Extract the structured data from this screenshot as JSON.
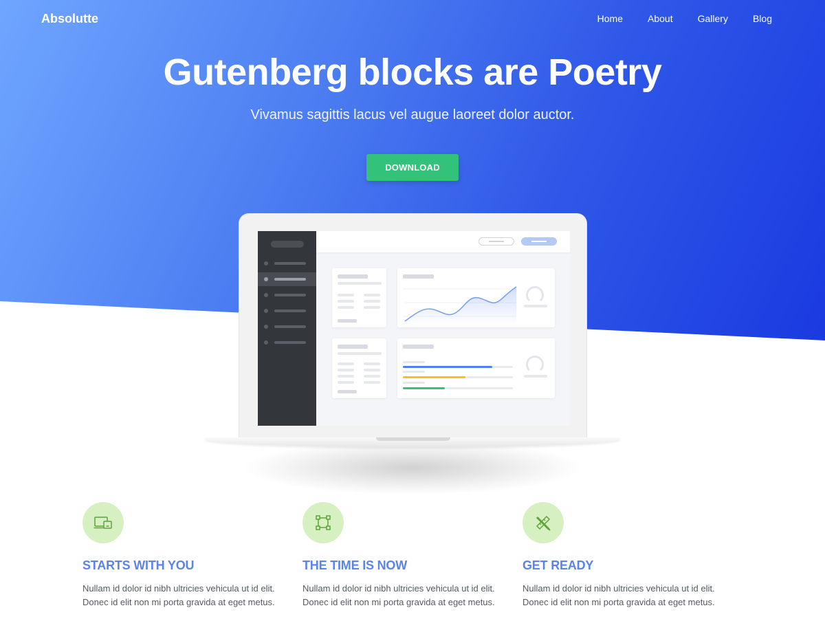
{
  "header": {
    "brand": "Absolutte",
    "nav": [
      {
        "label": "Home"
      },
      {
        "label": "About"
      },
      {
        "label": "Gallery"
      },
      {
        "label": "Blog"
      }
    ]
  },
  "hero": {
    "title": "Gutenberg blocks are Poetry",
    "subtitle": "Vivamus sagittis lacus vel augue laoreet dolor auctor.",
    "cta_label": "DOWNLOAD"
  },
  "colors": {
    "hero_gradient_start": "#6fa6ff",
    "hero_gradient_end": "#1a3ae0",
    "cta": "#33c27a",
    "feature_title": "#5b84e6",
    "feature_icon_bg": "#d7f0c2",
    "feature_icon_stroke": "#5fa33a"
  },
  "mockup": {
    "progress_bars": [
      {
        "color": "#4f7ff0",
        "fraction": 0.81
      },
      {
        "color": "#f4c21c",
        "fraction": 0.57
      },
      {
        "color": "#33c27a",
        "fraction": 0.38
      }
    ]
  },
  "features": [
    {
      "icon": "devices-icon",
      "title": "STARTS WITH YOU",
      "text_line1": "Nullam id dolor id nibh ultricies vehicula ut id elit.",
      "text_line2": "Donec id elit non mi porta gravida at eget metus."
    },
    {
      "icon": "crop-frame-icon",
      "title": "THE TIME IS NOW",
      "text_line1": "Nullam id dolor id nibh ultricies vehicula ut id elit.",
      "text_line2": "Donec id elit non mi porta gravida at eget metus."
    },
    {
      "icon": "pencil-ruler-icon",
      "title": "GET READY",
      "text_line1": "Nullam id dolor id nibh ultricies vehicula ut id elit.",
      "text_line2": "Donec id elit non mi porta gravida at eget metus."
    }
  ]
}
